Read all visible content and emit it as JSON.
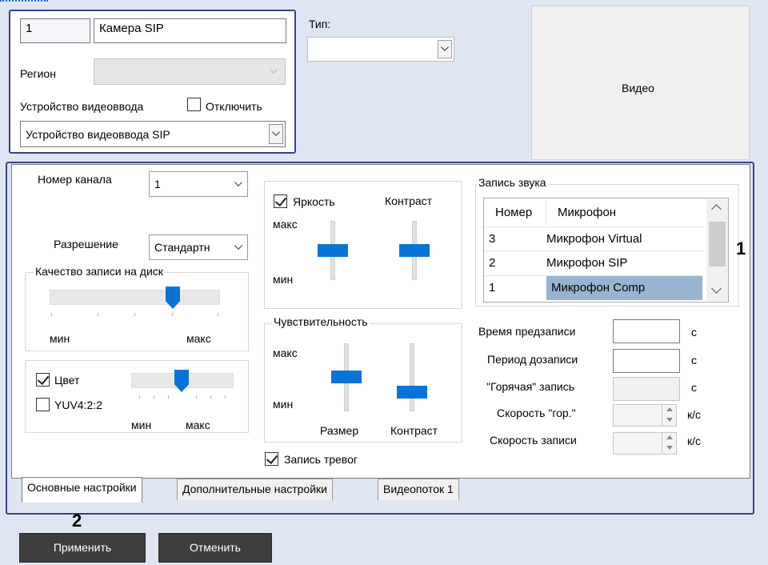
{
  "camera": {
    "id": "1",
    "name": "Камера SIP",
    "region_label": "Регион",
    "video_device_label": "Устройство видеоввода",
    "disable_label": "Отключить",
    "video_device_value": "Устройство видеоввода SIP",
    "type_label": "Тип:",
    "video_label": "Видео"
  },
  "channel": {
    "channel_label": "Номер канала",
    "channel_value": "1",
    "resolution_label": "Разрешение",
    "resolution_value": "Стандартн",
    "quality_group": "Качество записи на диск",
    "quality_min": "мин",
    "quality_max": "макс"
  },
  "image": {
    "brightness_label": "Яркость",
    "contrast_label": "Контраст",
    "max_label": "макс",
    "min_label": "мин"
  },
  "sensitivity": {
    "group": "Чувствительность",
    "max_label": "макс",
    "min_label": "мин",
    "size_label": "Размер",
    "contrast_label": "Контраст"
  },
  "color": {
    "color_label": "Цвет",
    "yuv_label": "YUV4:2:2",
    "min_label": "мин",
    "max_label": "макс"
  },
  "alarm_record_label": "Запись тревог",
  "audio": {
    "group": "Запись звука",
    "columns": [
      "Номер",
      "Микрофон"
    ],
    "rows": [
      {
        "num": "3",
        "name": "Микрофон Virtual"
      },
      {
        "num": "2",
        "name": "Микрофон SIP"
      },
      {
        "num": "1",
        "name": "Микрофон Comp"
      }
    ]
  },
  "timing": {
    "pre_record_label": "Время предзаписи",
    "post_record_label": "Период дозаписи",
    "hot_record_label": "\"Горячая\" запись",
    "hot_speed_label": "Скорость \"гор.\"",
    "record_speed_label": "Скорость записи",
    "unit_s": "с",
    "unit_fps": "к/с"
  },
  "tabs": [
    "Основные настройки",
    "Дополнительные настройки",
    "Видеопоток 1"
  ],
  "callouts": {
    "one": "1",
    "two": "2"
  },
  "buttons": {
    "apply": "Применить",
    "cancel": "Отменить"
  },
  "colors": {
    "accent": "#0a74d6",
    "selection": "#99b4d1",
    "panel": "#ffffff",
    "frame": "#3a3f8a"
  }
}
